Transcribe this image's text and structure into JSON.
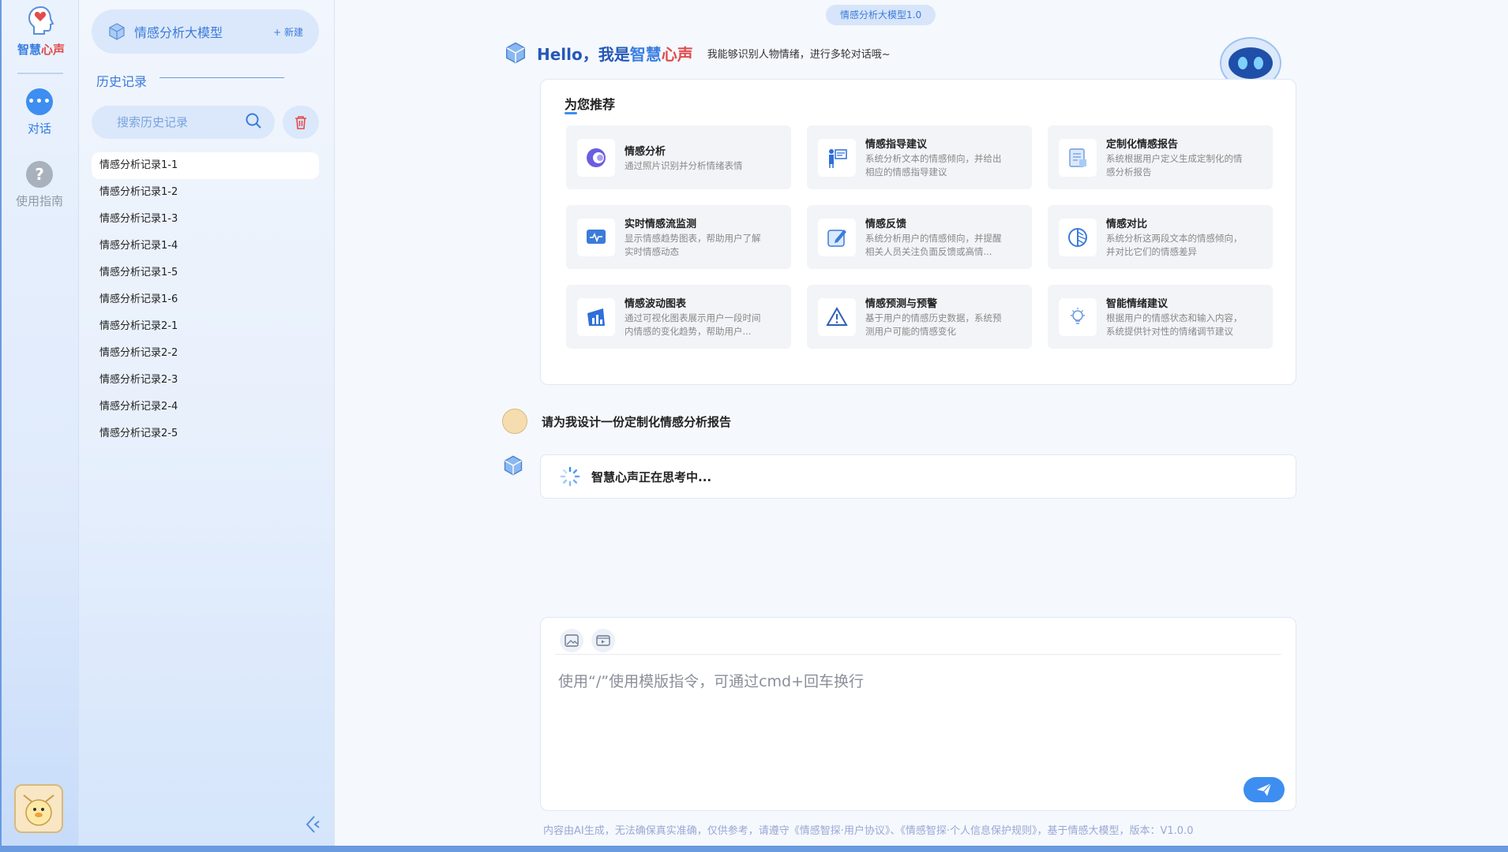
{
  "brand": {
    "part1": "智慧",
    "part2": "心声"
  },
  "rail": {
    "items": [
      {
        "label": "对话",
        "icon": "chat-bubble-icon"
      },
      {
        "label": "使用指南",
        "icon": "question-icon"
      }
    ]
  },
  "sidebar": {
    "model_label": "情感分析大模型",
    "new_label": "+ 新建",
    "history_title": "历史记录",
    "search_placeholder": "搜索历史记录",
    "history": [
      "情感分析记录1-1",
      "情感分析记录1-2",
      "情感分析记录1-3",
      "情感分析记录1-4",
      "情感分析记录1-5",
      "情感分析记录1-6",
      "情感分析记录2-1",
      "情感分析记录2-2",
      "情感分析记录2-3",
      "情感分析记录2-4",
      "情感分析记录2-5"
    ]
  },
  "main": {
    "version_badge": "情感分析大模型1.0",
    "hello_prefix": "Hello，我是",
    "hello_brand_a": "智慧",
    "hello_brand_b": "心声",
    "hello_sub": "我能够识别人物情绪，进行多轮对话哦~",
    "rec_title": "为您推荐",
    "recommendations": [
      {
        "name": "情感分析",
        "desc1": "通过照片识别并分析情绪表情",
        "desc2": "",
        "icon": "emotion-face-icon"
      },
      {
        "name": "情感指导建议",
        "desc1": "系统分析文本的情感倾向，并给出",
        "desc2": "相应的情感指导建议",
        "icon": "presentation-icon"
      },
      {
        "name": "定制化情感报告",
        "desc1": "系统根据用户定义生成定制化的情",
        "desc2": "感分析报告",
        "icon": "report-icon"
      },
      {
        "name": "实时情感流监测",
        "desc1": "显示情感趋势图表，帮助用户了解",
        "desc2": "实时情感动态",
        "icon": "monitor-icon"
      },
      {
        "name": "情感反馈",
        "desc1": "系统分析用户的情感倾向，并提醒",
        "desc2": "相关人员关注负面反馈或高情...",
        "icon": "feedback-edit-icon"
      },
      {
        "name": "情感对比",
        "desc1": "系统分析这两段文本的情感倾向，",
        "desc2": "并对比它们的情感差异",
        "icon": "compare-circle-icon"
      },
      {
        "name": "情感波动图表",
        "desc1": "通过可视化图表展示用户一段时间",
        "desc2": "内情感的变化趋势，帮助用户...",
        "icon": "bar-chart-icon"
      },
      {
        "name": "情感预测与预警",
        "desc1": "基于用户的情感历史数据，系统预",
        "desc2": "测用户可能的情感变化",
        "icon": "warning-icon"
      },
      {
        "name": "智能情绪建议",
        "desc1": "根据用户的情感状态和输入内容，",
        "desc2": "系统提供针对性的情绪调节建议",
        "icon": "lightbulb-icon"
      }
    ],
    "user_message": "请为我设计一份定制化情感分析报告",
    "thinking_text": "智慧心声正在思考中...",
    "input_placeholder": "使用“/”使用模版指令，可通过cmd+回车换行",
    "footer": "内容由AI生成，无法确保真实准确，仅供参考，请遵守《情感智探·用户协议》、《情感智探·个人信息保护规则》，基于情感大模型，版本：V1.0.0"
  },
  "colors": {
    "accent": "#3d8ef0",
    "brand_red": "#e24b4b",
    "brand_blue": "#3a7fe0"
  }
}
